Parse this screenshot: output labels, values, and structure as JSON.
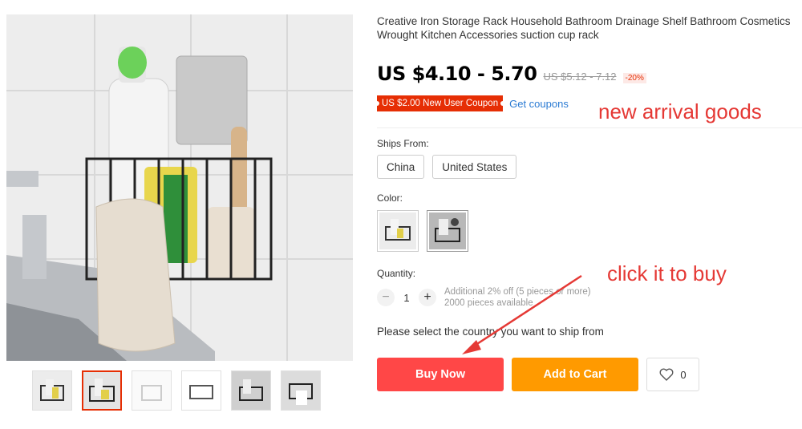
{
  "product": {
    "title": "Creative Iron Storage Rack Household Bathroom Drainage Shelf Bathroom Cosmetics Wrought Kitchen Accessories suction cup rack",
    "price": "US $4.10 - 5.70",
    "old_price": "US $5.12 - 7.12",
    "discount": "-20%"
  },
  "coupon": {
    "badge": "US $2.00 New User Coupon",
    "link": "Get coupons"
  },
  "annotations": {
    "new_arrival": "new arrival goods",
    "click_to_buy": "click it to buy"
  },
  "ships_from": {
    "label": "Ships From:",
    "options": [
      "China",
      "United States"
    ]
  },
  "color": {
    "label": "Color:"
  },
  "quantity": {
    "label": "Quantity:",
    "value": "1",
    "minus": "−",
    "plus": "+",
    "note_line1": "Additional 2% off (5 pieces or more)",
    "note_line2": "2000 pieces available"
  },
  "ship_note": "Please select the country you want to ship from",
  "buttons": {
    "buy_now": "Buy Now",
    "add_to_cart": "Add to Cart",
    "wishlist_count": "0"
  },
  "colors": {
    "accent_red": "#ff4747",
    "cart_orange": "#ff9a00",
    "annotation_red": "#e53935",
    "link_blue": "#2b7bd3"
  }
}
